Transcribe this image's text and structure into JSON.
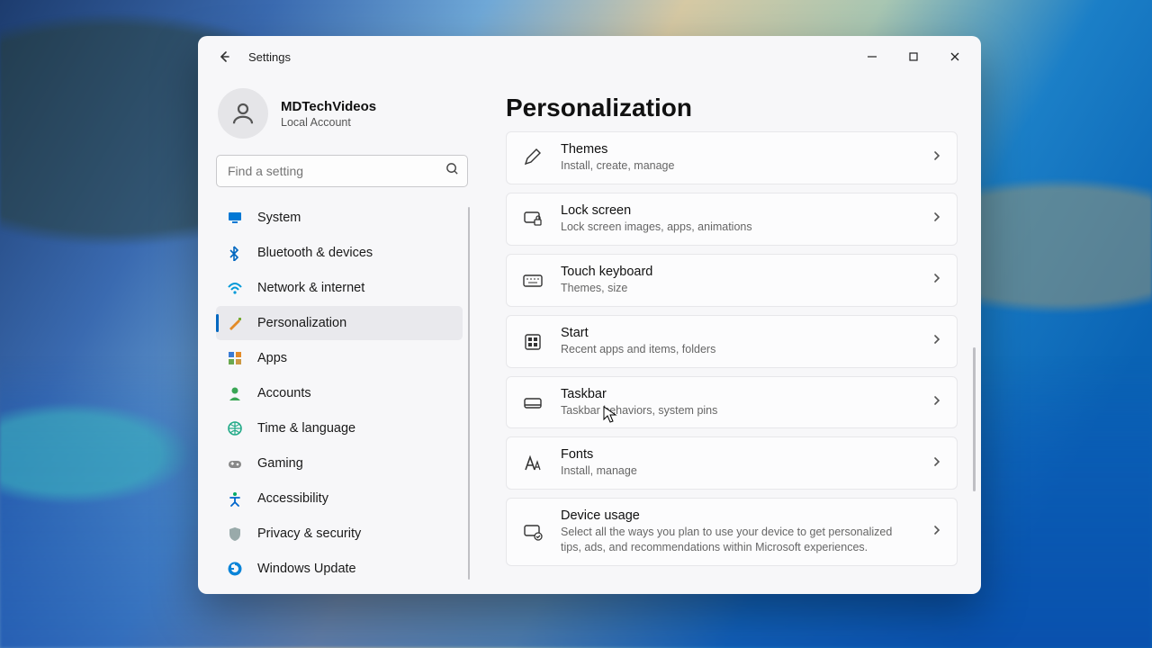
{
  "window": {
    "title": "Settings"
  },
  "profile": {
    "name": "MDTechVideos",
    "sub": "Local Account"
  },
  "search": {
    "placeholder": "Find a setting"
  },
  "sidebar": {
    "items": [
      {
        "label": "System",
        "icon": "monitor",
        "selected": false
      },
      {
        "label": "Bluetooth & devices",
        "icon": "bluetooth",
        "selected": false
      },
      {
        "label": "Network & internet",
        "icon": "wifi",
        "selected": false
      },
      {
        "label": "Personalization",
        "icon": "brush",
        "selected": true
      },
      {
        "label": "Apps",
        "icon": "grid",
        "selected": false
      },
      {
        "label": "Accounts",
        "icon": "person",
        "selected": false
      },
      {
        "label": "Time & language",
        "icon": "globe",
        "selected": false
      },
      {
        "label": "Gaming",
        "icon": "gamepad",
        "selected": false
      },
      {
        "label": "Accessibility",
        "icon": "accessibility",
        "selected": false
      },
      {
        "label": "Privacy & security",
        "icon": "shield",
        "selected": false
      },
      {
        "label": "Windows Update",
        "icon": "update",
        "selected": false
      }
    ]
  },
  "page": {
    "title": "Personalization"
  },
  "cards": [
    {
      "title": "Themes",
      "sub": "Install, create, manage",
      "icon": "pencil"
    },
    {
      "title": "Lock screen",
      "sub": "Lock screen images, apps, animations",
      "icon": "lock-monitor"
    },
    {
      "title": "Touch keyboard",
      "sub": "Themes, size",
      "icon": "keyboard"
    },
    {
      "title": "Start",
      "sub": "Recent apps and items, folders",
      "icon": "start"
    },
    {
      "title": "Taskbar",
      "sub": "Taskbar behaviors, system pins",
      "icon": "taskbar"
    },
    {
      "title": "Fonts",
      "sub": "Install, manage",
      "icon": "fonts"
    },
    {
      "title": "Device usage",
      "sub": "Select all the ways you plan to use your device to get personalized tips, ads, and recommendations within Microsoft experiences.",
      "icon": "device-check"
    }
  ],
  "colors": {
    "accent": "#0067c0"
  }
}
